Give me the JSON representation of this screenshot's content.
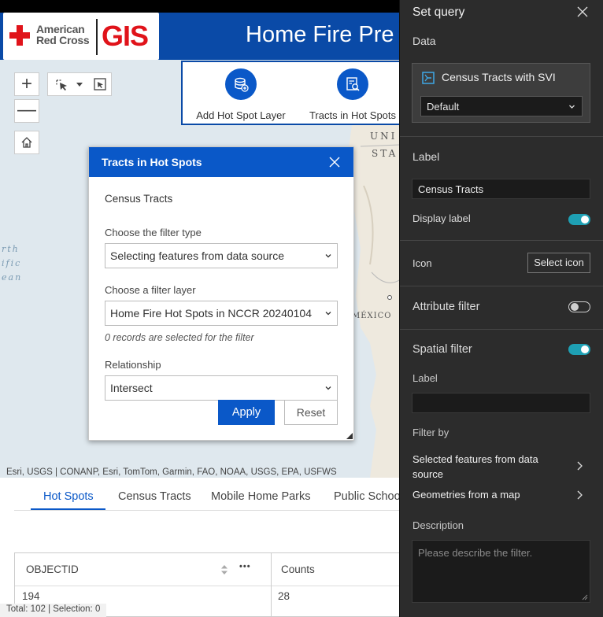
{
  "header": {
    "logo_line1": "American",
    "logo_line2": "Red Cross",
    "logo_gis": "GIS",
    "title": "Home Fire Pre"
  },
  "map": {
    "labels": {
      "country_us_1": "UNI",
      "country_us_2": "STA",
      "country_mexico": "MÉXICO",
      "ocean_1": "rth",
      "ocean_2": "ific",
      "ocean_3": "ean"
    },
    "attribution": "Esri, USGS | CONANP, Esri, TomTom, Garmin, FAO, NOAA, USGS, EPA, USFWS",
    "zoom_in": "+",
    "zoom_out": "—"
  },
  "toolbar": {
    "add_label": "Add Hot Spot Layer",
    "tracts_label": "Tracts in Hot Spots"
  },
  "dialog": {
    "title": "Tracts in Hot Spots",
    "subtitle": "Census Tracts",
    "filter_type_label": "Choose the filter type",
    "filter_type_value": "Selecting features from data source",
    "filter_layer_label": "Choose a filter layer",
    "filter_layer_value": "Home Fire Hot Spots in NCCR 20240104",
    "records_note": "0 records are selected for the filter",
    "relationship_label": "Relationship",
    "relationship_value": "Intersect",
    "apply": "Apply",
    "reset": "Reset"
  },
  "table": {
    "tabs": [
      "Hot Spots",
      "Census Tracts",
      "Mobile Home Parks",
      "Public Schoo"
    ],
    "active_tab": 0,
    "columns": [
      "OBJECTID",
      "Counts"
    ],
    "more": "•••",
    "rows": [
      [
        "194",
        "28"
      ]
    ],
    "status": "Total: 102 | Selection: 0"
  },
  "panel": {
    "title": "Set query",
    "data_heading": "Data",
    "data_source": "Census Tracts with SVI",
    "data_view": "Default",
    "label_heading": "Label",
    "label_value": "Census Tracts",
    "display_label": "Display label",
    "display_label_on": true,
    "icon_heading": "Icon",
    "select_icon": "Select icon",
    "attribute_filter": "Attribute filter",
    "attribute_filter_on": false,
    "spatial_filter": "Spatial filter",
    "spatial_filter_on": true,
    "spatial_label_heading": "Label",
    "filter_by_heading": "Filter by",
    "filter_by_option1": "Selected features from data source",
    "filter_by_option2": "Geometries from a map",
    "description_heading": "Description",
    "description_placeholder": "Please describe the filter."
  },
  "colors": {
    "brand_blue": "#0a58c8",
    "header_blue": "#0a4aa7",
    "toggle_on": "#1ea0b4",
    "redcross_red": "#e0131a",
    "panel_bg": "#2c2c2c"
  }
}
